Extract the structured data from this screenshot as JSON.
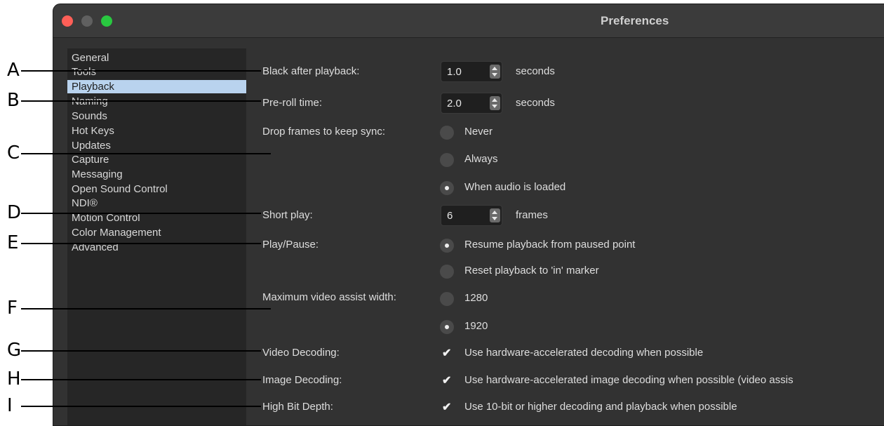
{
  "window": {
    "title": "Preferences"
  },
  "sidebar": {
    "items": [
      {
        "label": "General"
      },
      {
        "label": "Tools"
      },
      {
        "label": "Playback",
        "selected": true
      },
      {
        "label": "Naming"
      },
      {
        "label": "Sounds"
      },
      {
        "label": "Hot Keys"
      },
      {
        "label": "Updates"
      },
      {
        "label": "Capture"
      },
      {
        "label": "Messaging"
      },
      {
        "label": "Open Sound Control"
      },
      {
        "label": "NDI®"
      },
      {
        "label": "Motion Control"
      },
      {
        "label": "Color Management"
      },
      {
        "label": "Advanced"
      }
    ]
  },
  "settings": {
    "black_after": {
      "label": "Black after playback:",
      "value": "1.0",
      "unit": "seconds"
    },
    "preroll": {
      "label": "Pre-roll time:",
      "value": "2.0",
      "unit": "seconds"
    },
    "drop_frames": {
      "label": "Drop frames to keep sync:",
      "options": [
        "Never",
        "Always",
        "When audio is loaded"
      ],
      "selected": "When audio is loaded"
    },
    "short_play": {
      "label": "Short play:",
      "value": "6",
      "unit": "frames"
    },
    "play_pause": {
      "label": "Play/Pause:",
      "options": [
        "Resume playback from paused point",
        "Reset playback to 'in' marker"
      ],
      "selected": "Resume playback from paused point"
    },
    "max_video_assist": {
      "label": "Maximum video assist width:",
      "options": [
        "1280",
        "1920"
      ],
      "selected": "1920"
    },
    "video_decoding": {
      "label": "Video Decoding:",
      "checkbox": "Use hardware-accelerated decoding when possible",
      "checked": true
    },
    "image_decoding": {
      "label": "Image Decoding:",
      "checkbox": "Use hardware-accelerated image decoding when possible (video assis",
      "checked": true
    },
    "high_bit_depth": {
      "label": "High Bit Depth:",
      "checkbox": "Use 10-bit or higher decoding and playback when possible",
      "checked": true
    }
  },
  "callouts": [
    "A",
    "B",
    "C",
    "D",
    "E",
    "F",
    "G",
    "H",
    "I"
  ],
  "colors": {
    "selected_item": "#b9d3ee",
    "window_bg": "#323232",
    "sidebar_bg": "#262626"
  }
}
